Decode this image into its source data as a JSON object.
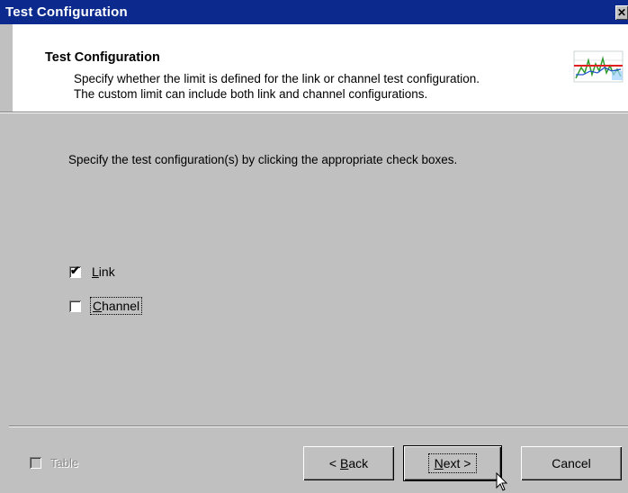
{
  "window": {
    "title": "Test Configuration",
    "close_glyph": "✕"
  },
  "header": {
    "title": "Test Configuration",
    "description_line1": "Specify whether the limit is defined for the link or channel test configuration.",
    "description_line2": "The custom limit can include both link and channel configurations.",
    "logo_icon": "wizard-chart-logo-icon"
  },
  "main": {
    "instruction": "Specify the test configuration(s) by clicking the appropriate check boxes.",
    "options": [
      {
        "label_mnemonic": "L",
        "label_rest": "ink",
        "checked": true
      },
      {
        "label_mnemonic": "C",
        "label_rest": "hannel",
        "checked": false
      }
    ]
  },
  "footer": {
    "table_label": "Table",
    "table_checked": false,
    "table_enabled": false,
    "back_label_prefix": "< ",
    "back_label_mnemonic": "B",
    "back_label_rest": "ack",
    "next_label_mnemonic": "N",
    "next_label_rest": "ext >",
    "cancel_label": "Cancel"
  },
  "colors": {
    "titlebar": "#0c2a8e",
    "dialog_face": "#c0c0c0",
    "header_bg": "#ffffff"
  }
}
